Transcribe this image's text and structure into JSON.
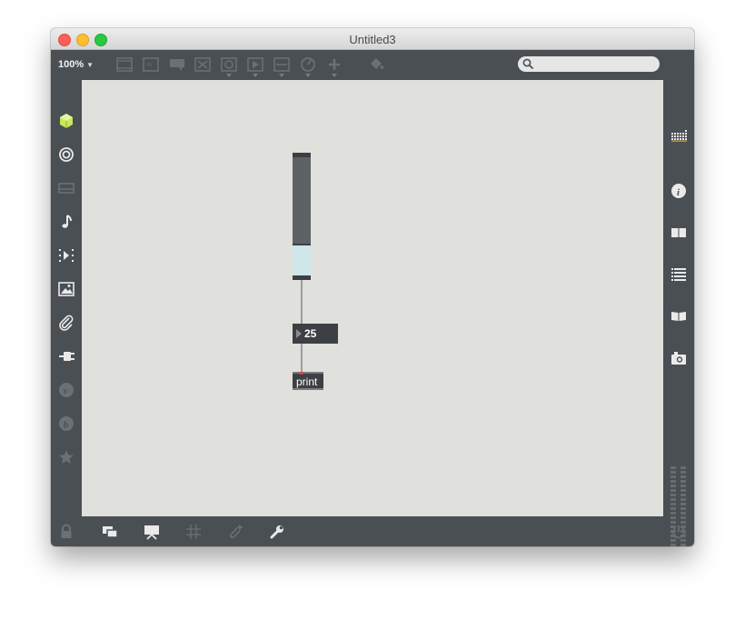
{
  "window": {
    "title": "Untitled3"
  },
  "toolbar": {
    "zoom_label": "100%",
    "search": {
      "value": "",
      "placeholder": ""
    },
    "tools": [
      {
        "name": "presentation-object-icon"
      },
      {
        "name": "message-object-icon"
      },
      {
        "name": "comment-icon"
      },
      {
        "name": "toggle-icon"
      },
      {
        "name": "button-icon"
      },
      {
        "name": "play-icon"
      },
      {
        "name": "slider-icon"
      },
      {
        "name": "dial-icon"
      },
      {
        "name": "add-icon"
      },
      {
        "name": "paint-bucket-icon"
      }
    ]
  },
  "left_sidebar": [
    {
      "name": "packages-icon"
    },
    {
      "name": "target-icon"
    },
    {
      "name": "media-icon"
    },
    {
      "name": "music-note-icon"
    },
    {
      "name": "sequencer-icon"
    },
    {
      "name": "image-icon"
    },
    {
      "name": "paperclip-icon"
    },
    {
      "name": "plug-icon"
    },
    {
      "name": "vizzie-icon"
    },
    {
      "name": "beap-icon"
    },
    {
      "name": "favorites-star-icon"
    }
  ],
  "right_sidebar": [
    {
      "name": "mixer-grid-icon"
    },
    {
      "name": "info-icon"
    },
    {
      "name": "reference-book-icon"
    },
    {
      "name": "list-icon"
    },
    {
      "name": "help-book-icon"
    },
    {
      "name": "snapshot-camera-icon"
    }
  ],
  "canvas": {
    "slider": {
      "value_fraction": 0.25
    },
    "number_box": {
      "value": "25"
    },
    "message_box": {
      "label": "print"
    }
  },
  "colors": {
    "chrome": "#4a4f54",
    "canvas": "#e0e0dc",
    "slider_fill": "#cfe6ea",
    "object_box": "#3c3f43",
    "lime_accent": "#c8e85a"
  }
}
